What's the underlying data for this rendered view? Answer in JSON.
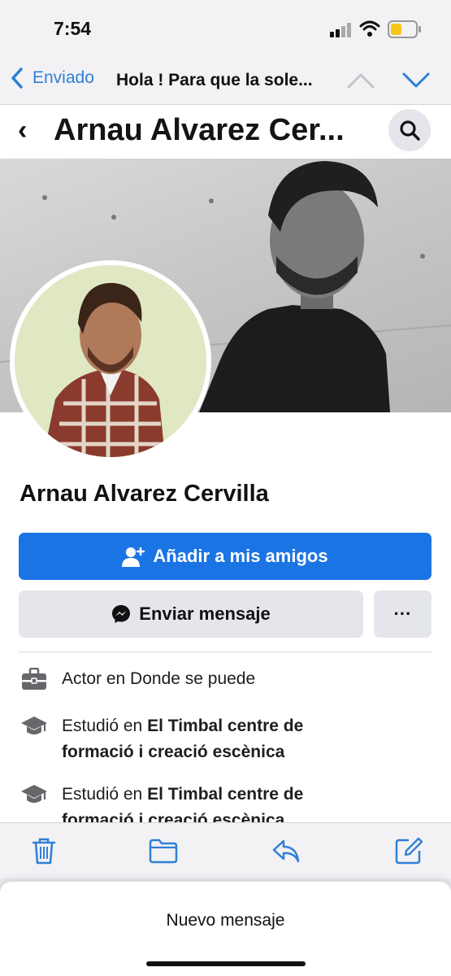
{
  "status_bar": {
    "time": "7:54"
  },
  "mail_header": {
    "back_label": "Enviado",
    "subject": "Hola ! Para que la sole..."
  },
  "profile": {
    "header_title": "Arnau Alvarez Cer...",
    "name": "Arnau Alvarez Cervilla",
    "add_friend_label": "Añadir a mis amigos",
    "send_message_label": "Enviar mensaje",
    "more_label": "···"
  },
  "details": [
    {
      "icon": "briefcase-icon",
      "prefix": "Actor en Donde se puede",
      "emphasis": "",
      "line2": ""
    },
    {
      "icon": "graduation-cap-icon",
      "prefix": "Estudió en ",
      "emphasis": "El Timbal centre de",
      "line2": "formació i creació escènica"
    },
    {
      "icon": "graduation-cap-icon",
      "prefix": "Estudió en ",
      "emphasis": "El Timbal centre de",
      "line2": "formació i creació escènica"
    }
  ],
  "toolbar": {
    "icons": [
      "trash-icon",
      "folder-icon",
      "reply-icon",
      "compose-icon"
    ]
  },
  "sheet": {
    "title": "Nuevo mensaje"
  },
  "colors": {
    "accent": "#2f7fd8",
    "facebook_blue": "#1b74e4"
  }
}
